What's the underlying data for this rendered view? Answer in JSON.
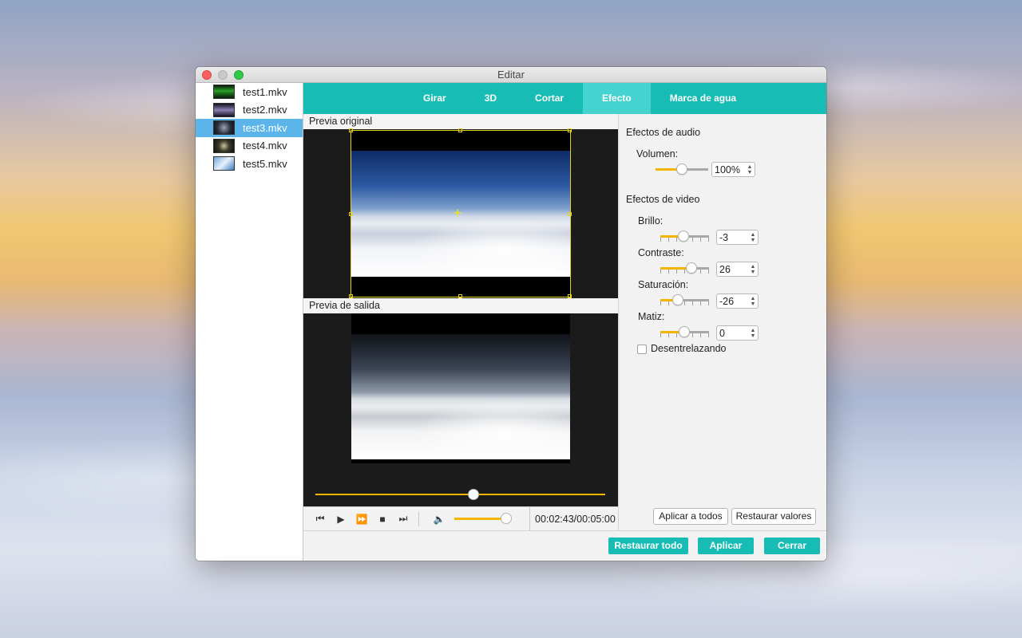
{
  "window": {
    "title": "Editar"
  },
  "files": [
    {
      "name": "test1.mkv",
      "selected": false
    },
    {
      "name": "test2.mkv",
      "selected": false
    },
    {
      "name": "test3.mkv",
      "selected": true
    },
    {
      "name": "test4.mkv",
      "selected": false
    },
    {
      "name": "test5.mkv",
      "selected": false
    }
  ],
  "tabs": [
    {
      "label": "Girar",
      "active": false
    },
    {
      "label": "3D",
      "active": false
    },
    {
      "label": "Cortar",
      "active": false
    },
    {
      "label": "Efecto",
      "active": true
    },
    {
      "label": "Marca de agua",
      "active": false
    }
  ],
  "preview": {
    "original_label": "Previa original",
    "output_label": "Previa de salida",
    "time": "00:02:43/00:05:00",
    "playback_fraction": 0.55,
    "volume_fraction": 0.9
  },
  "audio": {
    "title": "Efectos de audio",
    "volume_label": "Volumen:",
    "volume_value": "100%",
    "volume_fraction": 0.5
  },
  "video": {
    "title": "Efectos de video",
    "brightness": {
      "label": "Brillo:",
      "value": "-3"
    },
    "contrast": {
      "label": "Contraste:",
      "value": "26"
    },
    "saturation": {
      "label": "Saturación:",
      "value": "-26"
    },
    "hue": {
      "label": "Matiz:",
      "value": "0"
    },
    "deinterlace_label": "Desentrelazando",
    "deinterlace_checked": false
  },
  "buttons": {
    "apply_all": "Aplicar a todos",
    "restore_values": "Restaurar valores",
    "restore_all": "Restaurar todo",
    "apply": "Aplicar",
    "close": "Cerrar"
  },
  "colors": {
    "accent_teal": "#17bdb4",
    "active_tab": "#44d3cf",
    "slider_fill": "#f5b400",
    "selection_blue": "#5bb5ea"
  }
}
